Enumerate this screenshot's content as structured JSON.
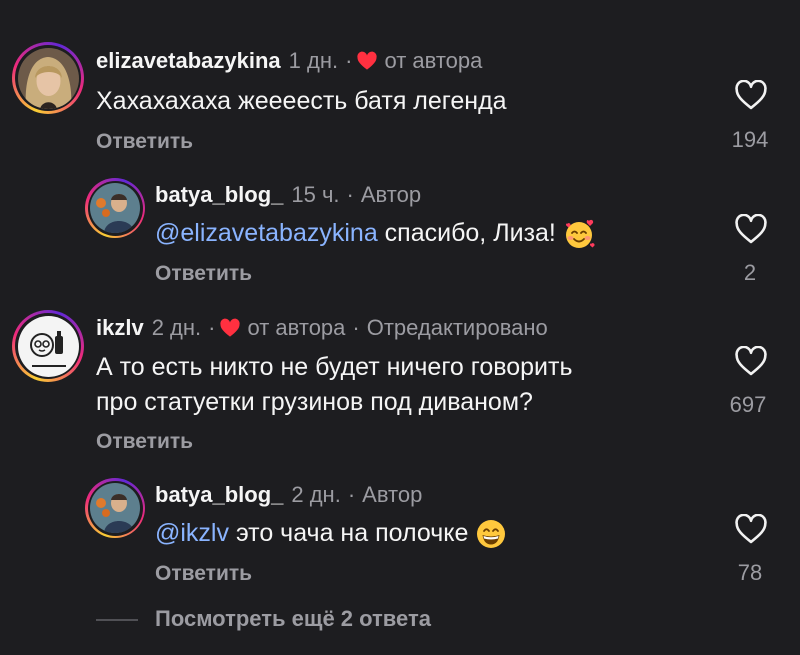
{
  "comments": [
    {
      "username": "elizavetabazykina",
      "time": "1 дн.",
      "dot": "·",
      "liked_by_author": "от автора",
      "text": "Хахахахаха жеееесть батя легенда",
      "reply_label": "Ответить",
      "likes": "194"
    },
    {
      "username": "batya_blog_",
      "time": "15 ч.",
      "dot": "·",
      "author_badge": "Автор",
      "mention": "@elizavetabazykina",
      "text": "спасибо, Лиза!",
      "emoji": "smiling-face-with-hearts",
      "reply_label": "Ответить",
      "likes": "2"
    },
    {
      "username": "ikzlv",
      "time": "2 дн.",
      "dot": "·",
      "liked_by_author": "от автора",
      "edited": "Отредактировано",
      "text_line1": "А то есть никто не будет ничего говорить",
      "text_line2": "про статуетки грузинов под диваном?",
      "reply_label": "Ответить",
      "likes": "697"
    },
    {
      "username": "batya_blog_",
      "time": "2 дн.",
      "dot": "·",
      "author_badge": "Автор",
      "mention": "@ikzlv",
      "text": "это чача на полочке",
      "emoji": "grinning-face",
      "reply_label": "Ответить",
      "likes": "78"
    }
  ],
  "view_more": "Посмотреть ещё 2 ответа",
  "colors": {
    "background": "#1d1d20",
    "heart_red": "#ff3040",
    "mention_blue": "#8ab4ff",
    "muted": "#9c9ca2"
  }
}
